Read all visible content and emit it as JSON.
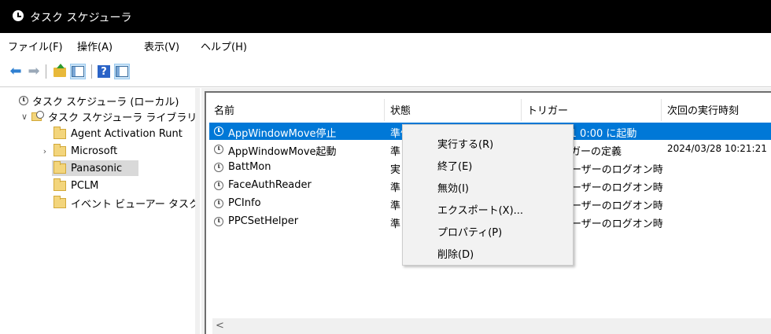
{
  "window": {
    "title": "タスク スケジューラ"
  },
  "menu": [
    "ファイル(F)",
    "操作(A)",
    "表示(V)",
    "ヘルプ(H)"
  ],
  "toolbar": {
    "icons": [
      "back-arrow-icon",
      "forward-arrow-icon",
      "folder-up-icon",
      "show-hide-console-tree-icon",
      "help-icon",
      "action-pane-icon"
    ]
  },
  "tree": [
    {
      "label": "タスク スケジューラ (ローカル)"
    },
    {
      "label": "タスク スケジューラ ライブラリ",
      "expanded": true
    },
    {
      "label": "Agent Activation Runt"
    },
    {
      "label": "Microsoft",
      "collapsed": true
    },
    {
      "label": "Panasonic",
      "selected": true
    },
    {
      "label": "PCLM"
    },
    {
      "label": "イベント ビューアー タスク"
    }
  ],
  "table": {
    "columns": [
      "名前",
      "状態",
      "トリガー",
      "次回の実行時刻"
    ],
    "rows": [
      {
        "name": "AppWindowMove停止",
        "status": "準備完了",
        "trigger": "/01 0:00 に起動",
        "next": "",
        "selected": true
      },
      {
        "name": "AppWindowMove起動",
        "status": "準",
        "trigger": "リガーの定義",
        "next": "2024/03/28 10:21:21"
      },
      {
        "name": "BattMon",
        "status": "実",
        "trigger": "ーザーのログオン時",
        "next": ""
      },
      {
        "name": "FaceAuthReader",
        "status": "準",
        "trigger": "ーザーのログオン時",
        "next": ""
      },
      {
        "name": "PCInfo",
        "status": "準",
        "trigger": "ーザーのログオン時",
        "next": ""
      },
      {
        "name": "PPCSetHelper",
        "status": "準",
        "trigger": "ーザーのログオン時",
        "next": ""
      }
    ]
  },
  "scroll": {
    "left_arrow": "<"
  },
  "context_menu": [
    "実行する(R)",
    "終了(E)",
    "無効(I)",
    "エクスポート(X)...",
    "プロパティ(P)",
    "削除(D)"
  ]
}
